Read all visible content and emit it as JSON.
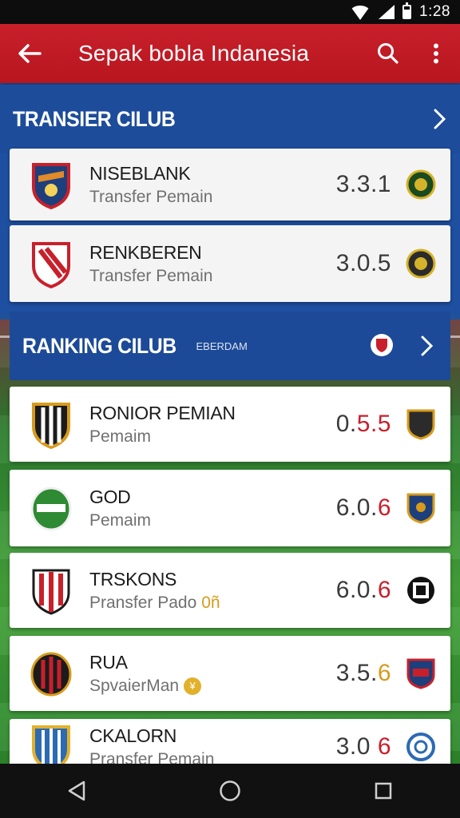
{
  "status_bar": {
    "time": "1:28"
  },
  "app_bar": {
    "title": "Sepak bobla Indanesia",
    "back_icon": "back-arrow-icon",
    "search_icon": "search-icon",
    "menu_icon": "more-vertical-icon"
  },
  "transfer_section": {
    "title": "TRANSIER CILUB",
    "items": [
      {
        "name": "NISEBLANK",
        "subtitle": "Transfer Pemain",
        "score": "3.3.1"
      },
      {
        "name": "RENKBEREN",
        "subtitle": "Transfer Pemain",
        "score": "3.0.5"
      }
    ]
  },
  "ranking_section": {
    "title": "RANKING CILUB",
    "subtitle": "EBERDAM",
    "items": [
      {
        "name": "RONIOR PEMIAN",
        "subtitle": "Pemaim",
        "score_a": "0.",
        "score_b": "5.5"
      },
      {
        "name": "GOD",
        "subtitle": "Pemaim",
        "score_a": "6.0.",
        "score_b": "6"
      },
      {
        "name": "TRSKONS",
        "subtitle": "Pransfer Pado",
        "subtitle_extra": "0ñ",
        "score_a": "6.0.",
        "score_b": "6"
      },
      {
        "name": "RUA",
        "subtitle": "SpvaierMan",
        "score_a": "3.5.",
        "score_b": "6"
      },
      {
        "name": "CKALORN",
        "subtitle": "Pransfer Pemain",
        "score_a": "3.0",
        "score_b": "6"
      }
    ]
  },
  "colors": {
    "primary_red": "#c8202b",
    "header_blue": "#1d4c9b",
    "gold": "#d79b1c"
  }
}
